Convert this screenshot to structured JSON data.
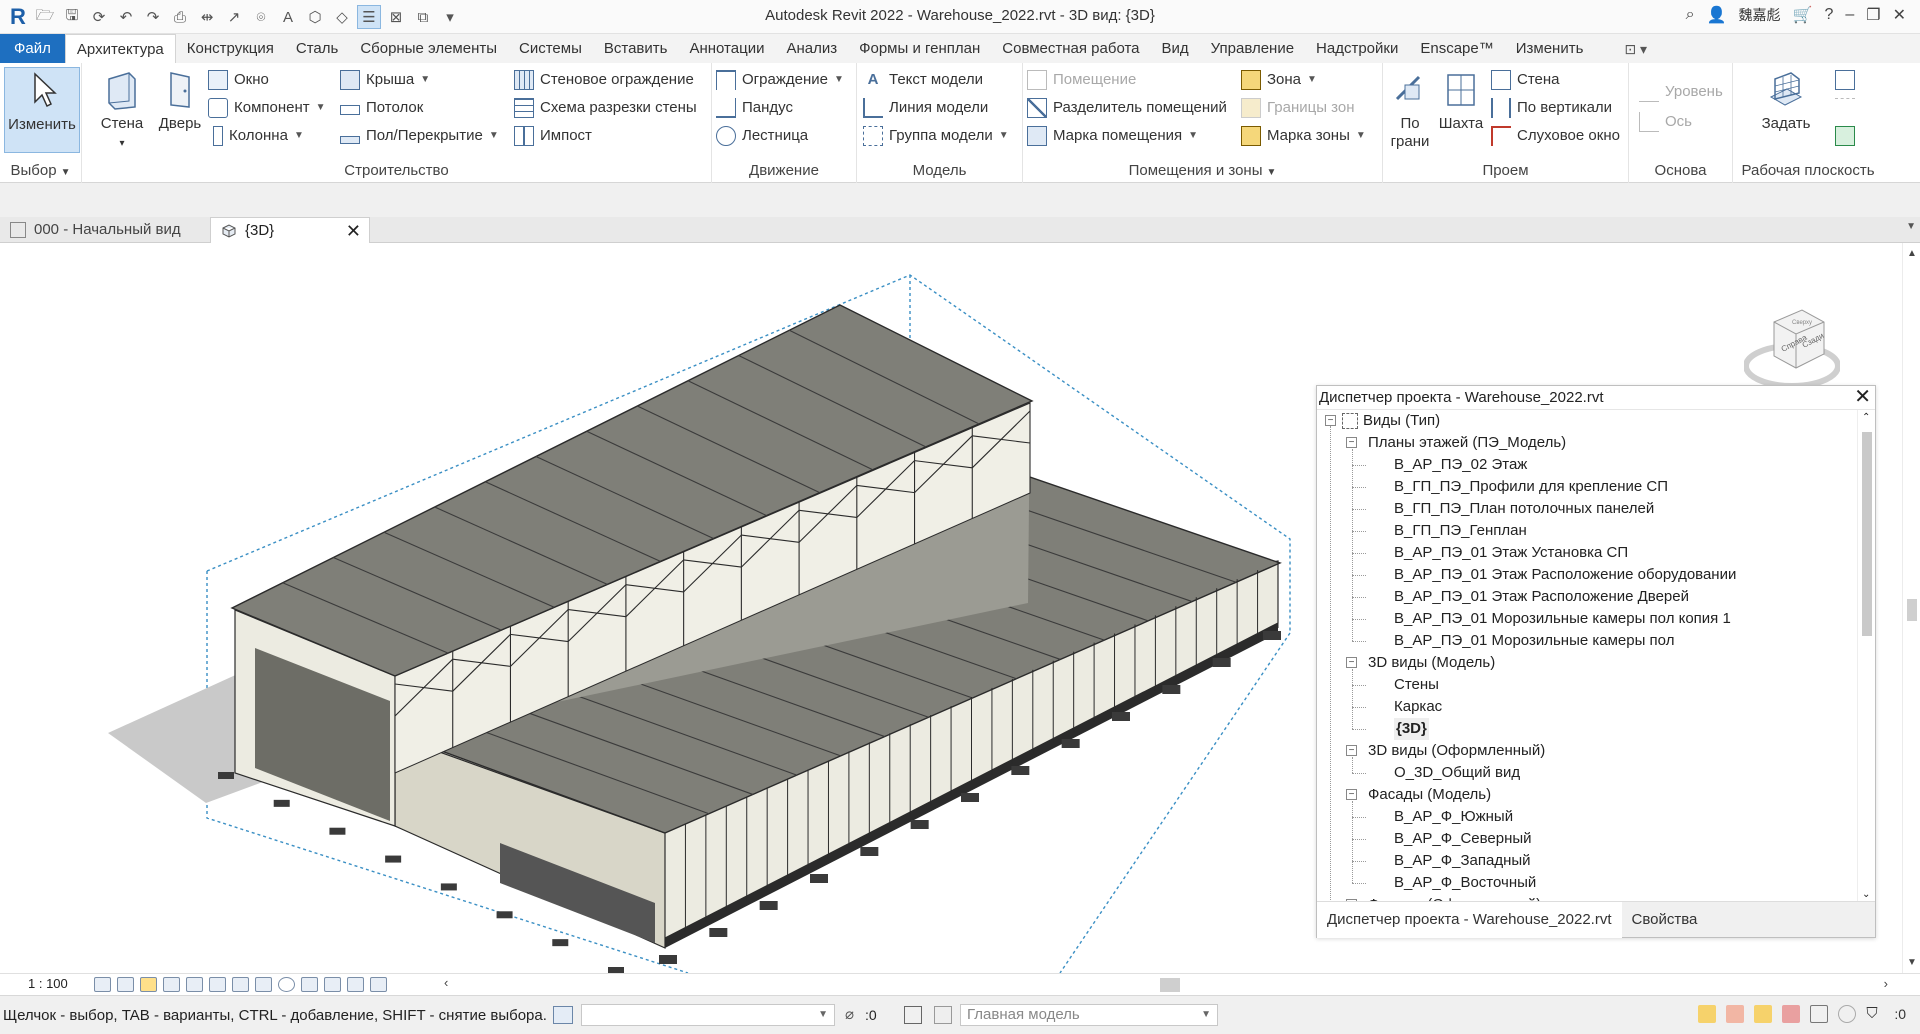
{
  "app": {
    "title": "Autodesk Revit 2022 - Warehouse_2022.rvt - 3D вид: {3D}",
    "user": "魏嘉彪",
    "window_controls": [
      "–",
      "❐",
      "✕"
    ]
  },
  "ribbon_tabs": [
    "Файл",
    "Архитектура",
    "Конструкция",
    "Сталь",
    "Сборные элементы",
    "Системы",
    "Вставить",
    "Аннотации",
    "Анализ",
    "Формы и генплан",
    "Совместная работа",
    "Вид",
    "Управление",
    "Надстройки",
    "Enscape™",
    "Изменить"
  ],
  "ribbon": {
    "select": {
      "modify": "Изменить",
      "label": "Выбор"
    },
    "build": {
      "wall": "Стена",
      "door": "Дверь",
      "window": "Окно",
      "component": "Компонент",
      "column": "Колонна",
      "roof": "Крыша",
      "ceiling": "Потолок",
      "floor": "Пол/Перекрытие",
      "curtain_system": "Стеновое ограждение",
      "curtain_grid": "Схема разрезки стены",
      "mullion": "Импост",
      "label": "Строительство"
    },
    "circulation": {
      "railing": "Ограждение",
      "ramp": "Пандус",
      "stair": "Лестница",
      "label": "Движение"
    },
    "model": {
      "model_text": "Текст модели",
      "model_line": "Линия  модели",
      "model_group": "Группа модели",
      "label": "Модель"
    },
    "room": {
      "room": "Помещение",
      "room_separator": "Разделитель помещений",
      "tag_room": "Марка помещения",
      "area": "Зона",
      "area_boundary": "Границы  зон",
      "tag_area": "Марка  зоны",
      "label": "Помещения и зоны"
    },
    "opening": {
      "by_face": "По\nграни",
      "shaft": "Шахта",
      "wall": "Стена",
      "vertical": "По вертикали",
      "dormer": "Слуховое окно",
      "label": "Проем"
    },
    "datum": {
      "level": "Уровень",
      "grid": "Ось",
      "label": "Основа"
    },
    "work_plane": {
      "set": "Задать",
      "label": "Рабочая плоскость"
    }
  },
  "doc_tabs": [
    {
      "label": "000 - Начальный вид"
    },
    {
      "label": "{3D}",
      "active": true
    }
  ],
  "project_browser": {
    "title": "Диспетчер проекта - Warehouse_2022.rvt",
    "root": "Виды (Тип)",
    "groups": [
      {
        "label": "Планы этажей (ПЭ_Модель)",
        "items": [
          "В_АР_ПЭ_02 Этаж",
          "В_ГП_ПЭ_Профили для крепление СП",
          "В_ГП_ПЭ_План потолочных панелей",
          "В_ГП_ПЭ_Генплан",
          "В_АР_ПЭ_01 Этаж Установка СП",
          "В_АР_ПЭ_01 Этаж Расположение оборудовании",
          "В_АР_ПЭ_01 Этаж Расположение Дверей",
          "В_АР_ПЭ_01 Морозильные камеры пол копия 1",
          "В_АР_ПЭ_01 Морозильные камеры пол"
        ]
      },
      {
        "label": "3D виды (Модель)",
        "items": [
          "Стены",
          "Каркас",
          "{3D}"
        ]
      },
      {
        "label": "3D виды (Оформленный)",
        "items": [
          "О_3D_Общий вид"
        ]
      },
      {
        "label": "Фасады (Модель)",
        "items": [
          "В_АР_Ф_Южный",
          "В_АР_Ф_Северный",
          "В_АР_Ф_Западный",
          "В_АР_Ф_Восточный"
        ]
      },
      {
        "label": "Фасады (Оформленный)",
        "items": []
      }
    ],
    "footer_tabs": [
      "Диспетчер проекта - Warehouse_2022.rvt",
      "Свойства"
    ]
  },
  "view_bar": {
    "scale": "1 : 100"
  },
  "status_bar": {
    "hint": "Щелчок - выбор, TAB - варианты, CTRL - добавление, SHIFT - снятие выбора.",
    "workset_count": ":0",
    "model_combo": "Главная модель",
    "filter_count": ":0"
  },
  "viewcube": {
    "faces": [
      "Справа",
      "Сзади",
      "Сверху"
    ]
  },
  "colors": {
    "accent": "#1e6fc0",
    "roof": "#7f7f78",
    "wall": "#e9e6d6",
    "frame": "#2b2b2b",
    "bbox": "#3a8fc4"
  }
}
